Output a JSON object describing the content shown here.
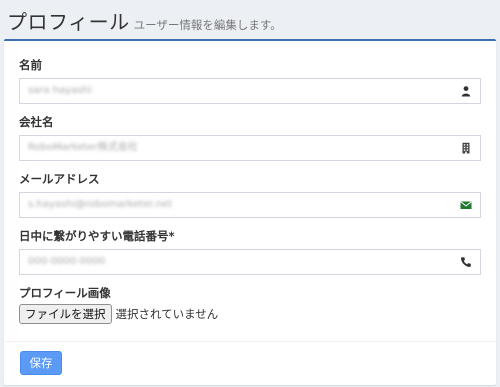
{
  "header": {
    "title": "プロフィール",
    "subtitle": "ユーザー情報を編集します。"
  },
  "form": {
    "name": {
      "label": "名前",
      "value": "sara hayashi",
      "icon": "user-icon"
    },
    "company": {
      "label": "会社名",
      "value": "RoboMarketer株式会社",
      "icon": "building-icon"
    },
    "email": {
      "label": "メールアドレス",
      "value": "s.hayashi@robomarketer.net",
      "icon": "envelope-icon"
    },
    "phone": {
      "label": "日中に繋がりやすい電話番号*",
      "value": "000-0000-0000",
      "icon": "phone-icon"
    },
    "image": {
      "label": "プロフィール画像",
      "button_label": "ファイルを選択",
      "status": "選択されていません"
    },
    "save_label": "保存"
  },
  "colors": {
    "accent": "#3c6fb0",
    "save_button": "#5b9bf5",
    "envelope_icon": "#1f7a2f"
  }
}
